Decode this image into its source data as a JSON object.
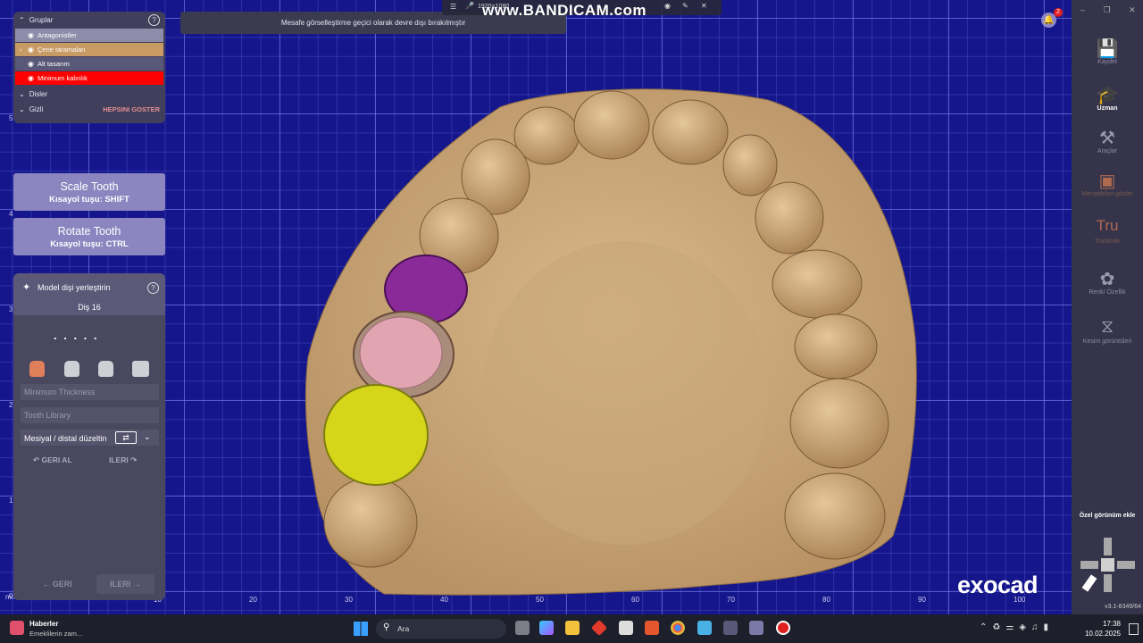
{
  "groups_panel": {
    "title": "Gruplar",
    "items": [
      {
        "label": "Antagonistler",
        "color": "#8e8ca8"
      },
      {
        "label": "Çene taramaları",
        "color": "#c89a64"
      },
      {
        "label": "Alt tasarım",
        "color": "#5a5878"
      },
      {
        "label": "Minimum kalınlık",
        "color": "#ff0000"
      }
    ],
    "disler": "Disler",
    "gizli": "Gizli",
    "show_all": "HEPSINI GOSTER"
  },
  "scale_button": {
    "title": "Scale Tooth",
    "shortcut": "Kısayol tuşu: SHIFT"
  },
  "rotate_button": {
    "title": "Rotate Tooth",
    "shortcut": "Kısayol tuşu: CTRL"
  },
  "wizard": {
    "title": "Model dişi yerleştirin",
    "tooth": "Diş 16",
    "dots": ". . . . .",
    "min_thickness": "Minimum Thickness",
    "tooth_library": "Tooth Library",
    "mesial": "Mesiyal / distal düzeltin",
    "undo": "GERI AL",
    "redo": "ILERI",
    "back": "GERI",
    "next": "ILERI"
  },
  "notice": "Mesafe görselleştirme geçici olarak devre dışı bırakılmıştır",
  "recorder": {
    "resolution": "1920×1080",
    "watermark": "www.BANDICAM.com"
  },
  "right_panel": {
    "items": [
      "Kaydet",
      "Uzman",
      "Araçlar",
      "Menşebileri göster",
      "TruSmile",
      "Renk/ Özellik",
      "Kesim görüntüleri"
    ],
    "tru": "Tru",
    "custom_view": "Özel görünüm ekle",
    "version": "v3.1-8349/64",
    "brand": "exocad",
    "notif_count": "2"
  },
  "ruler": {
    "unit": "mm",
    "x_ticks": [
      "10",
      "20",
      "30",
      "40",
      "50",
      "60",
      "70",
      "80",
      "90",
      "100"
    ],
    "y_ticks": [
      "5",
      "4",
      "3",
      "2",
      "1",
      "0"
    ]
  },
  "taskbar": {
    "news_title": "Haberler",
    "news_sub": "Emeklilerin zam...",
    "search": "Ara",
    "time": "17:38",
    "date": "10.02.2025"
  }
}
